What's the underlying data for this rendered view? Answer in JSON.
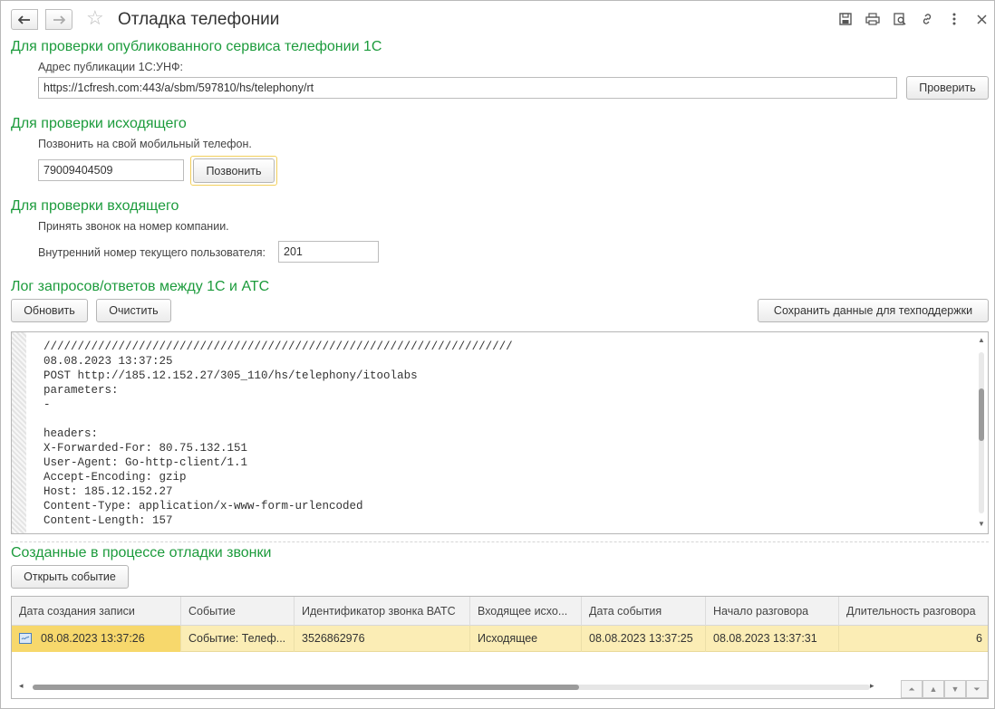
{
  "window": {
    "title": "Отладка телефонии",
    "toolbar_icons": [
      "back-arrow-icon",
      "forward-arrow-icon",
      "star-icon",
      "save-icon",
      "print-icon",
      "preview-icon",
      "link-icon",
      "more-vertical-icon",
      "close-icon"
    ]
  },
  "published_service": {
    "section_title": "Для проверки опубликованного сервиса телефонии 1С",
    "address_label": "Адрес публикации 1С:УНФ:",
    "address_value": "https://1cfresh.com:443/a/sbm/597810/hs/telephony/rt",
    "check_button": "Проверить"
  },
  "outgoing": {
    "section_title": "Для проверки исходящего",
    "hint": "Позвонить на свой мобильный телефон.",
    "phone_value": "79009404509",
    "call_button": "Позвонить"
  },
  "incoming": {
    "section_title": "Для проверки входящего",
    "hint": "Принять звонок на номер компании.",
    "ext_label": "Внутренний номер текущего пользователя:",
    "ext_value": "201"
  },
  "log": {
    "section_title": "Лог запросов/ответов между 1С и АТС",
    "refresh_button": "Обновить",
    "clear_button": "Очистить",
    "save_button": "Сохранить данные для техподдержки",
    "lines": [
      "/////////////////////////////////////////////////////////////////////",
      "08.08.2023 13:37:25",
      "POST http://185.12.152.27/305_110/hs/telephony/itoolabs",
      "parameters:",
      "-",
      "",
      "headers:",
      "X-Forwarded-For: 80.75.132.151",
      "User-Agent: Go-http-client/1.1",
      "Accept-Encoding: gzip",
      "Host: 185.12.152.27",
      "Content-Type: application/x-www-form-urlencoded",
      "Content-Length: 157"
    ]
  },
  "calls": {
    "section_title": "Созданные в процессе отладки звонки",
    "open_button": "Открыть событие",
    "columns": [
      "Дата создания записи",
      "Событие",
      "Идентификатор звонка ВАТС",
      "Входящее исхо...",
      "Дата события",
      "Начало разговора",
      "Длительность разговора"
    ],
    "rows": [
      [
        "08.08.2023 13:37:26",
        "Событие: Телеф...",
        "3526862976",
        "Исходящее",
        "08.08.2023 13:37:25",
        "08.08.2023 13:37:31",
        "6"
      ]
    ]
  }
}
